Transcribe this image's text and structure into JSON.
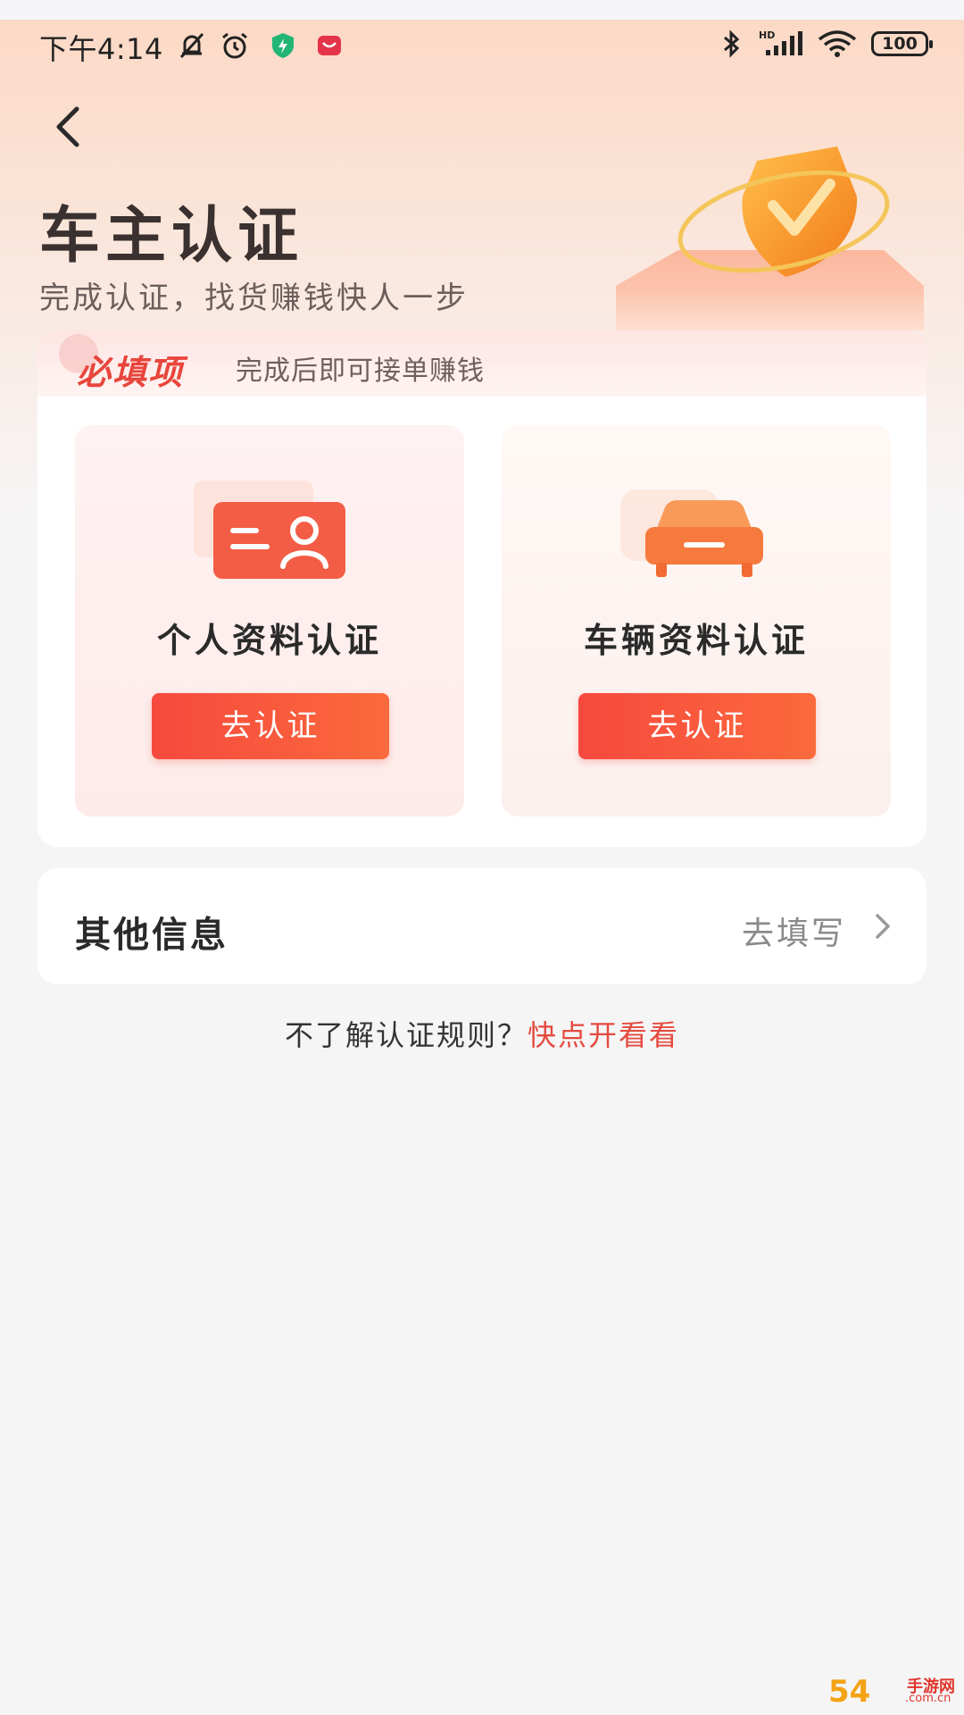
{
  "status_bar": {
    "time": "下午4:14",
    "battery": "100",
    "icons": [
      "mute-bell-icon",
      "alarm-icon",
      "shield-app-icon",
      "app-badge-icon",
      "bluetooth-icon",
      "hd-signal-icon",
      "wifi-icon",
      "battery-icon"
    ]
  },
  "header": {
    "title": "车主认证",
    "subtitle": "完成认证，找货赚钱快人一步"
  },
  "required": {
    "label": "必填项",
    "hint": "完成后即可接单赚钱",
    "tiles": [
      {
        "title": "个人资料认证",
        "button": "去认证",
        "icon": "id-card-icon"
      },
      {
        "title": "车辆资料认证",
        "button": "去认证",
        "icon": "car-icon"
      }
    ]
  },
  "other_info": {
    "title": "其他信息",
    "action": "去填写"
  },
  "rules": {
    "question": "不了解认证规则？",
    "link": "快点开看看"
  },
  "watermark": {
    "logo_text": "54",
    "cn": "手游网",
    "domain": ".com.cn"
  },
  "colors": {
    "accent": "#f6493e",
    "link": "#e44a3f",
    "required_label": "#e8453c"
  }
}
